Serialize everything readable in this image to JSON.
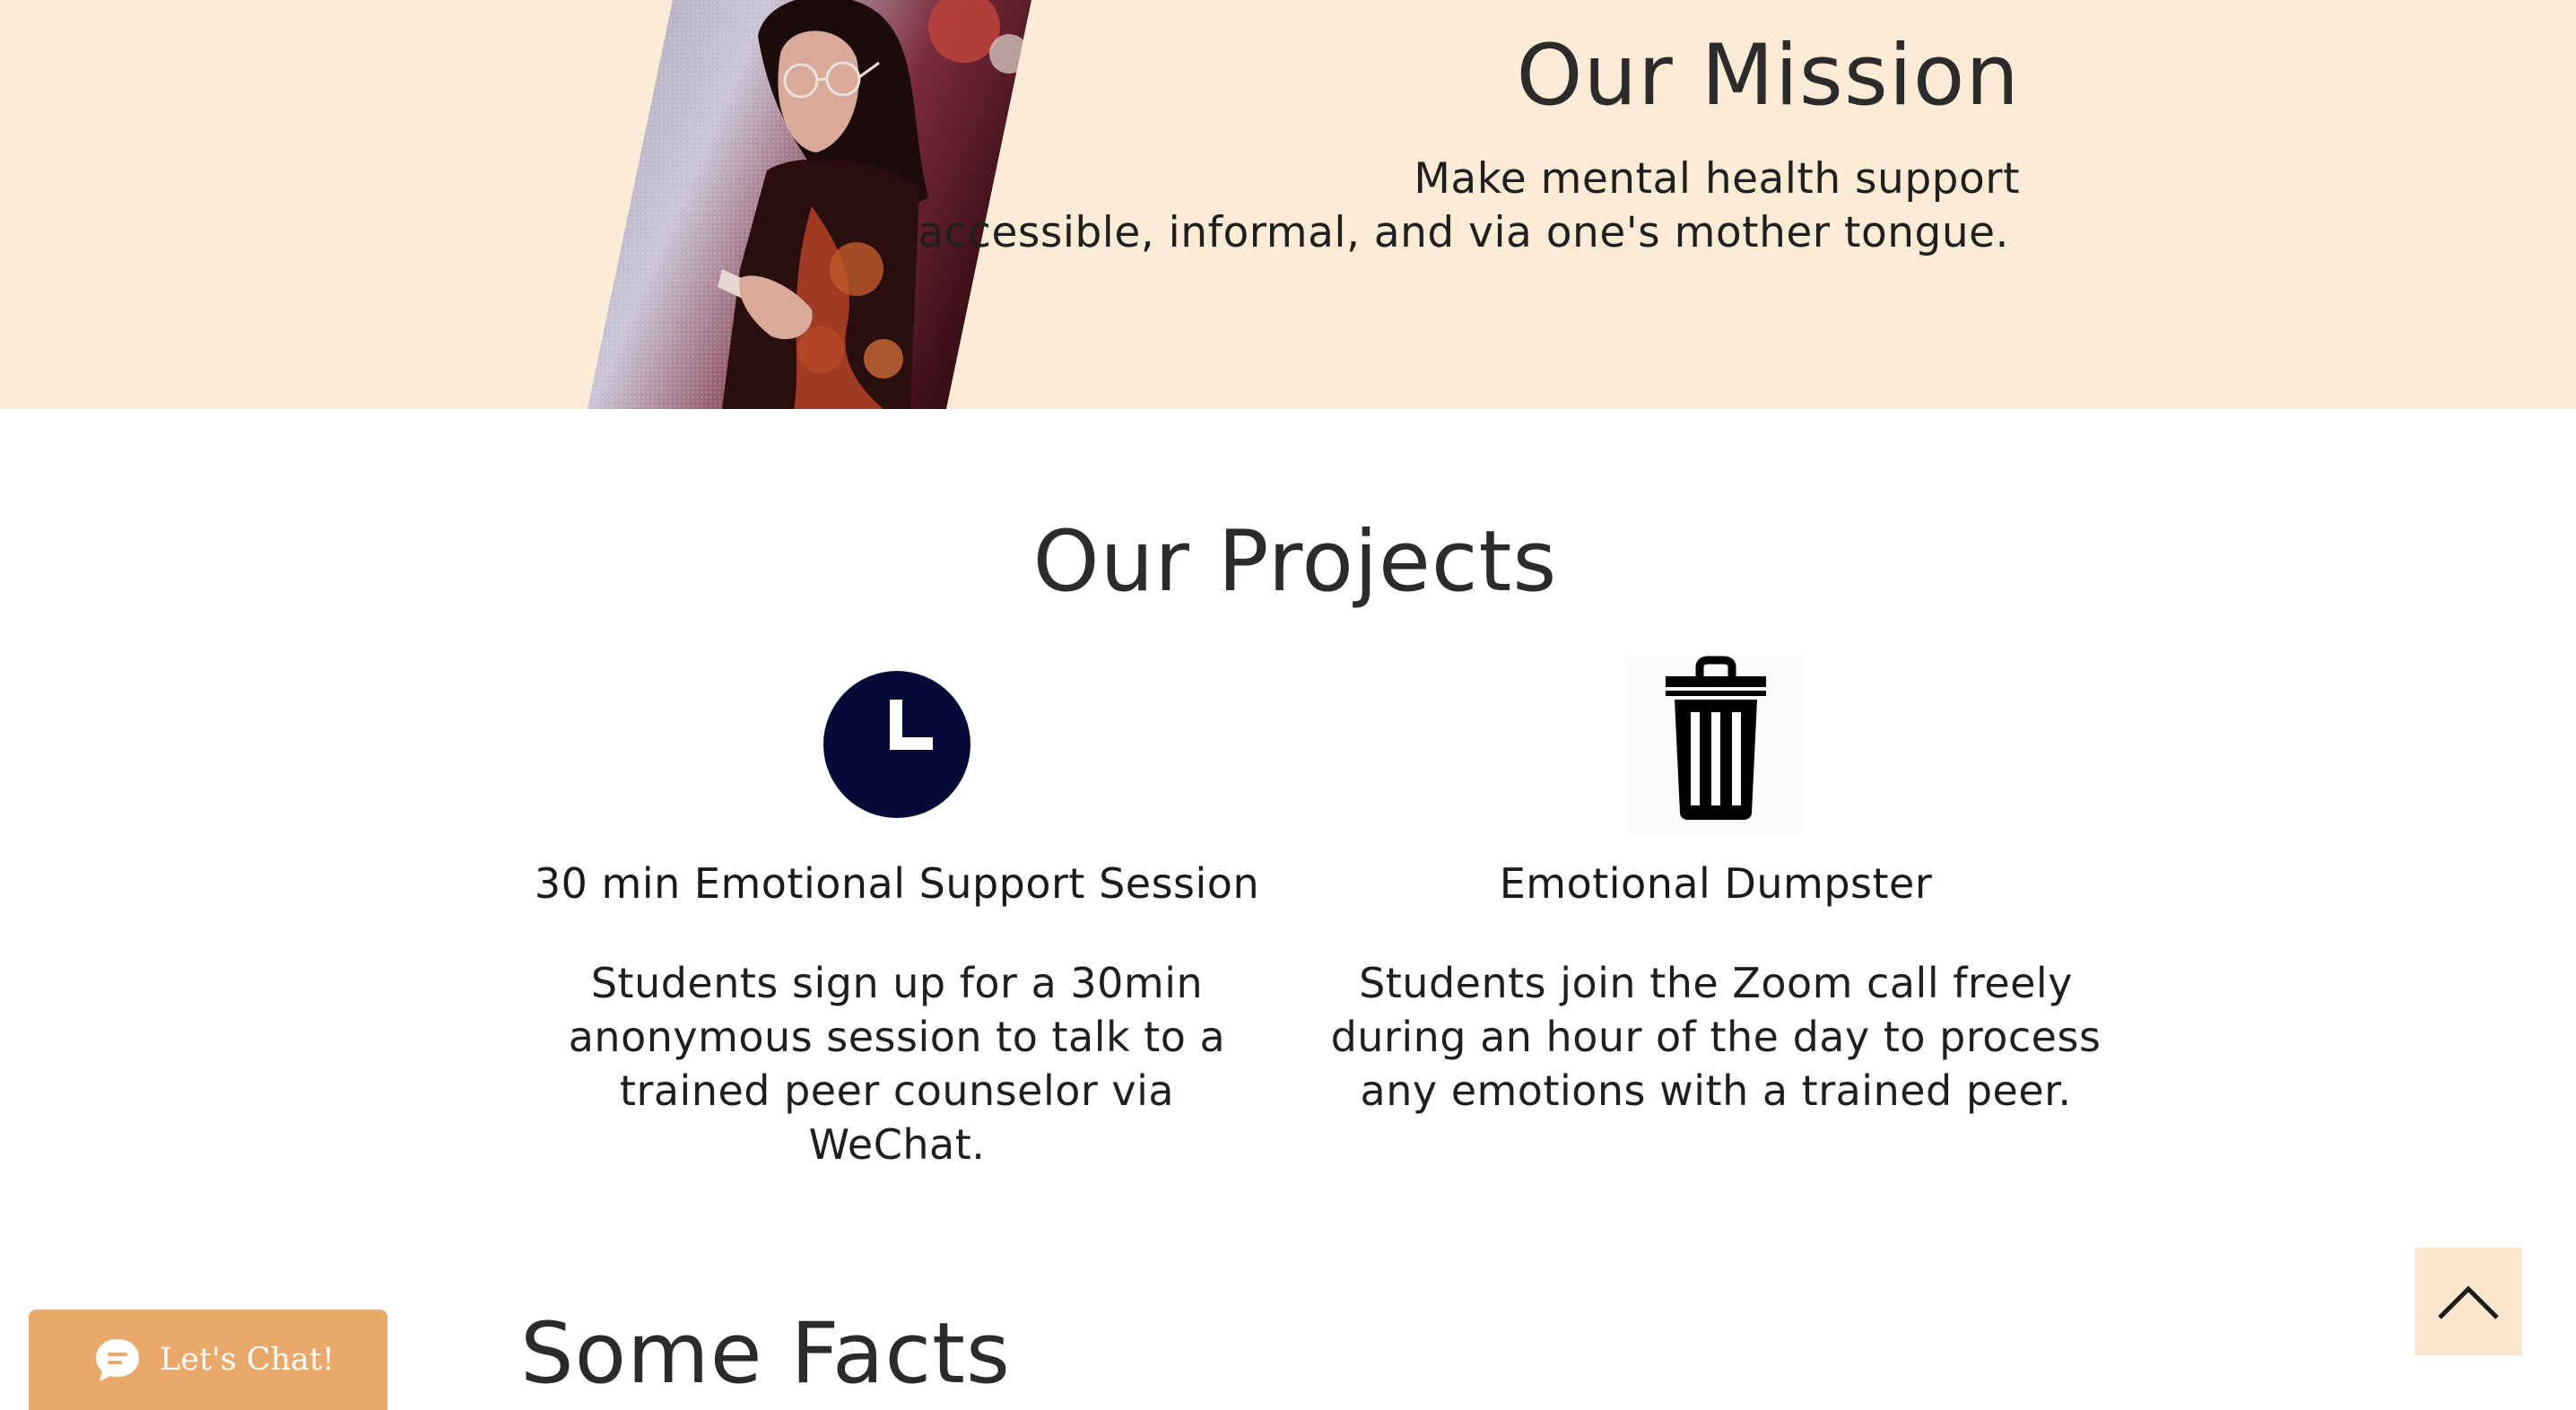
{
  "mission": {
    "title": "Our Mission",
    "line1": "Make mental health support",
    "line2": "accessible, informal, and via one's mother tongue."
  },
  "projects": {
    "title": "Our Projects",
    "items": [
      {
        "heading": "30 min Emotional Support Session",
        "description": "Students sign up for a 30min anonymous session to talk to a trained peer counselor via WeChat.",
        "icon": "clock-icon"
      },
      {
        "heading": "Emotional Dumpster",
        "description": "Students join the Zoom call freely during an hour of the day to process any emotions with a trained peer.",
        "icon": "trash-icon"
      }
    ]
  },
  "facts": {
    "title": "Some Facts"
  },
  "chat": {
    "label": "Let's Chat!",
    "icon": "chat-bubble-icon"
  },
  "back_to_top": {
    "icon": "chevron-up-icon"
  },
  "colors": {
    "mission_background": "#fcecd6",
    "clock_navy": "#050a36",
    "chat_orange": "#eba86b",
    "top_button_background": "#fbe6cf"
  }
}
